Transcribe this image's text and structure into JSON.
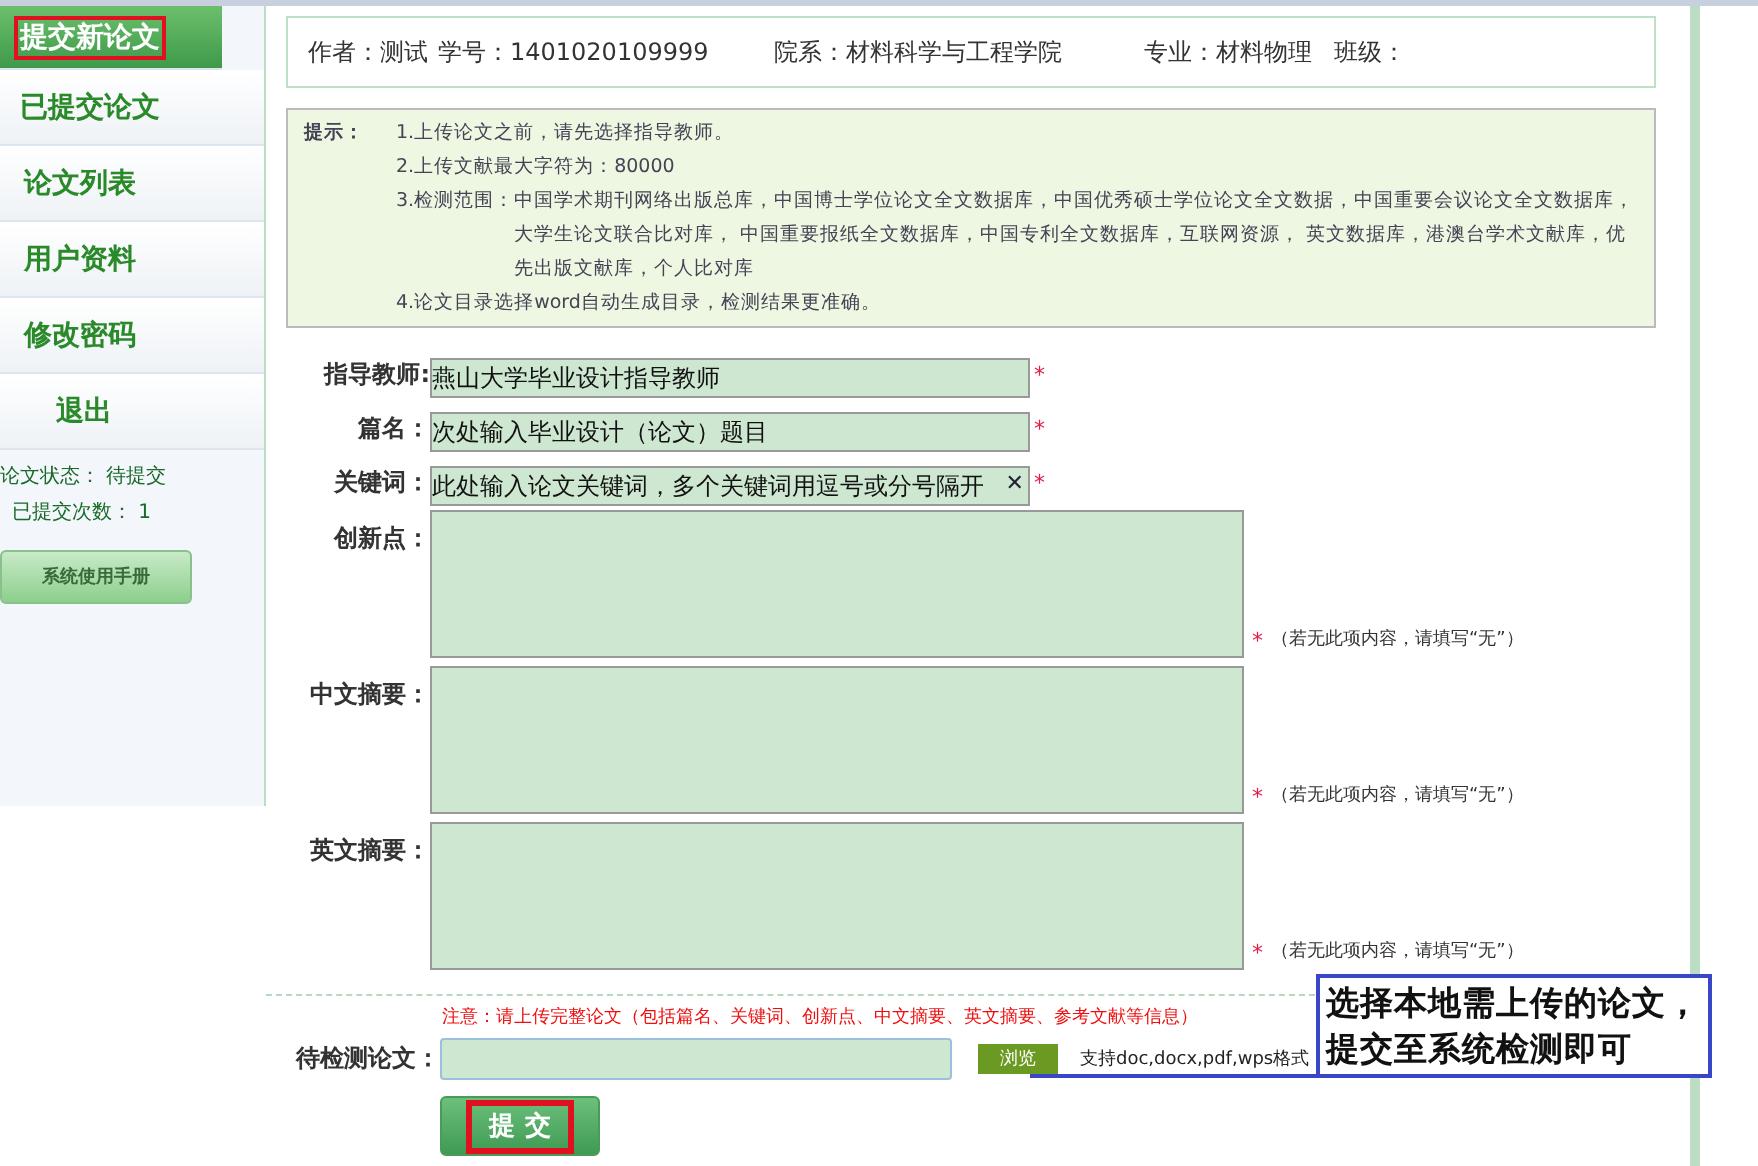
{
  "sidebar": {
    "items": [
      {
        "label": "提交新论文",
        "selected": true,
        "highlighted": true
      },
      {
        "label": "已提交论文",
        "selected": false,
        "highlighted": false
      },
      {
        "label": "论文列表",
        "selected": false,
        "highlighted": false
      },
      {
        "label": "用户资料",
        "selected": false,
        "highlighted": false
      },
      {
        "label": "修改密码",
        "selected": false,
        "highlighted": false
      },
      {
        "label": "退出",
        "selected": false,
        "highlighted": false
      }
    ],
    "status": [
      {
        "label": "论文状态：",
        "value": "待提交"
      },
      {
        "label": "已提交次数：",
        "value": "1"
      }
    ],
    "manual_button": "系统使用手册"
  },
  "user_info": [
    {
      "label": "作者：",
      "value": "测试"
    },
    {
      "label": "学号：",
      "value": "1401020109999"
    },
    {
      "label": "院系：",
      "value": "材料科学与工程学院"
    },
    {
      "label": "专业：",
      "value": "材料物理"
    },
    {
      "label": "班级："
    }
  ],
  "tips": {
    "label": "提示：",
    "items": [
      {
        "lead": "1.上传论文之前，请先选择指导教师。"
      },
      {
        "lead": "2.上传文献最大字符为：80000"
      },
      {
        "lead": "3.检测范围：",
        "text": "中国学术期刊网络出版总库，中国博士学位论文全文数据库，中国优秀硕士学位论文全文数据，中国重要会议论文全文数据库，大学生论文联合比对库， 中国重要报纸全文数据库，中国专利全文数据库，互联网资源， 英文数据库，港澳台学术文献库，优先出版文献库，个人比对库"
      },
      {
        "lead": "4.论文目录选择word自动生成目录，检测结果更准确。"
      }
    ]
  },
  "form": {
    "fields": [
      {
        "kind": "input",
        "label": "指导教师:",
        "value": "燕山大学毕业设计指导教师",
        "marker": "*"
      },
      {
        "kind": "input",
        "label": "篇名：",
        "value": "次处输入毕业设计（论文）题目",
        "marker": "*"
      },
      {
        "kind": "input",
        "label": "关键词：",
        "value": "此处输入论文关键词，多个关键词用逗号或分号隔开",
        "marker": "*",
        "clear_icon": "✕"
      },
      {
        "kind": "textarea",
        "label": "创新点：",
        "hint": "（若无此项内容，请填写“无”）",
        "marker": "*"
      },
      {
        "kind": "textarea",
        "label": "中文摘要：",
        "hint": "（若无此项内容，请填写“无”）",
        "marker": "*"
      },
      {
        "kind": "textarea",
        "label": "英文摘要：",
        "hint": "（若无此项内容，请填写“无”）",
        "marker": "*"
      }
    ],
    "notice": "注意：请上传完整论文（包括篇名、关键词、创新点、中文摘要、英文摘要、参考文献等信息）",
    "file_label": "待检测论文：",
    "browse_button": "浏览",
    "formats": "支持doc,docx,pdf,wps格式",
    "submit_button": {
      "label": "提 交",
      "highlighted": true
    }
  },
  "callout": {
    "lines": [
      "选择本地需上传的论文，",
      "提交至系统检测即可"
    ]
  }
}
